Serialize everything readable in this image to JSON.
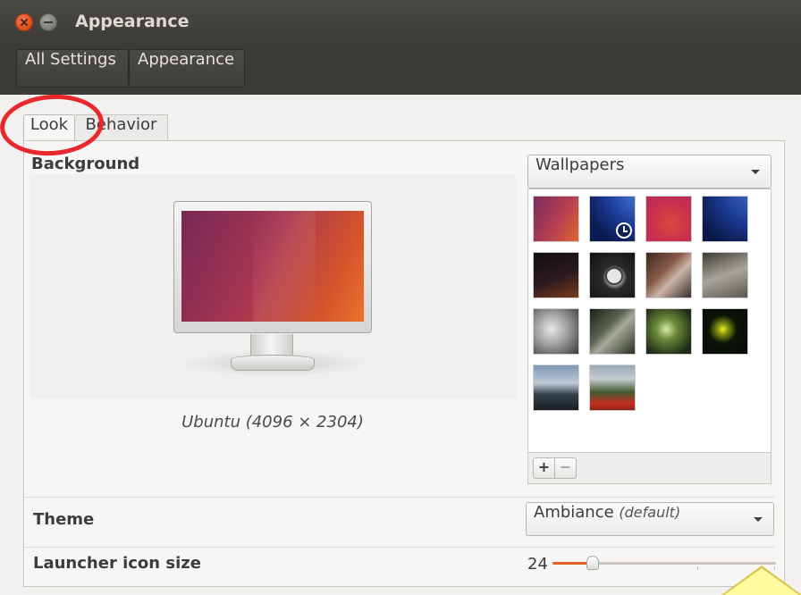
{
  "window": {
    "title": "Appearance"
  },
  "breadcrumb": {
    "all_settings": "All Settings",
    "current": "Appearance"
  },
  "tabs": [
    {
      "label": "Look",
      "active": true
    },
    {
      "label": "Behavior",
      "active": false
    }
  ],
  "background": {
    "label": "Background",
    "source_selected": "Wallpapers",
    "wallpaper_caption": "Ubuntu (4096 × 2304)",
    "thumbnails": [
      {
        "name": "ubuntu-default",
        "selected": true
      },
      {
        "name": "blue-planet-clock"
      },
      {
        "name": "red-radial"
      },
      {
        "name": "blue-planet"
      },
      {
        "name": "night-sky"
      },
      {
        "name": "clock-face"
      },
      {
        "name": "macro-abstract"
      },
      {
        "name": "grass-seeds"
      },
      {
        "name": "frost"
      },
      {
        "name": "forest-dark"
      },
      {
        "name": "leaf-macro"
      },
      {
        "name": "yellow-flower"
      },
      {
        "name": "landscape-clouds"
      },
      {
        "name": "red-poppies"
      }
    ],
    "add_button": "+",
    "remove_button": "−"
  },
  "theme": {
    "label": "Theme",
    "value": "Ambiance",
    "default_note": "(default)"
  },
  "launcher": {
    "label": "Launcher icon size",
    "value": "24",
    "level": 0.18
  },
  "colors": {
    "accent": "#e0622a",
    "annotation_circle": "#e8282d",
    "titlebar": "#3c3b37"
  }
}
